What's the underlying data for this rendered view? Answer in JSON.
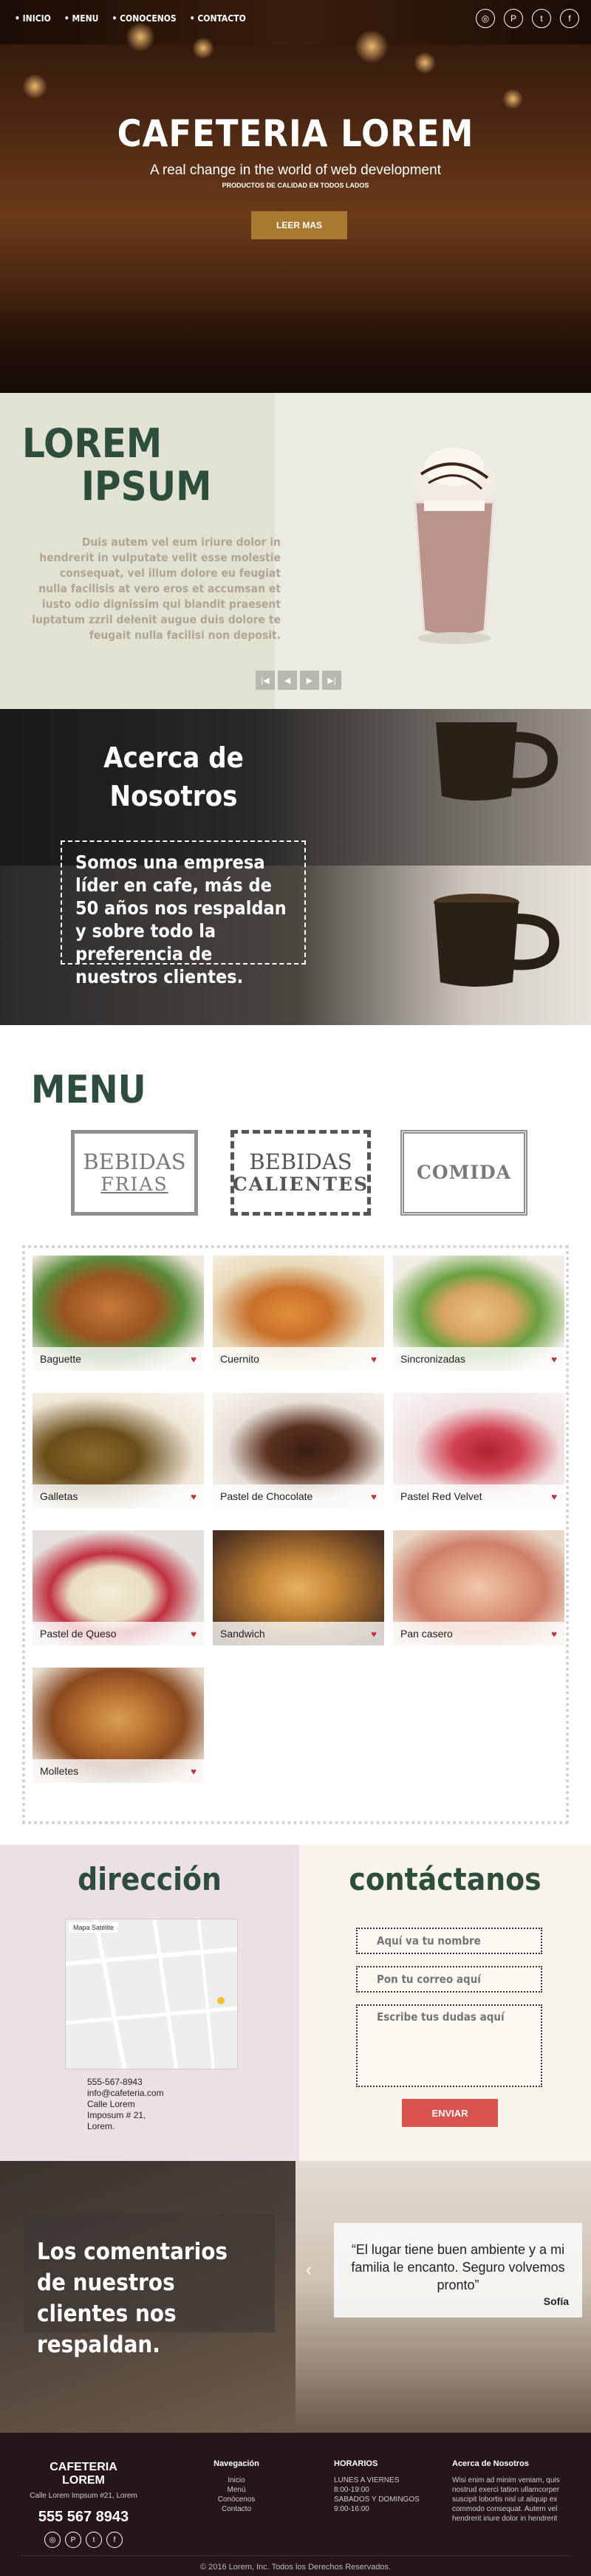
{
  "nav": {
    "items": [
      "• INICIO",
      "• MENU",
      "• CONOCENOS",
      "• CONTACTO"
    ]
  },
  "social": [
    "instagram-icon",
    "pinterest-icon",
    "twitter-icon",
    "facebook-icon"
  ],
  "hero": {
    "title": "CAFETERIA LOREM",
    "subtitle": "A real change in the world of web development",
    "tagline": "PRODUCTOS DE CALIDAD EN TODOS LADOS",
    "button": "LEER MAS"
  },
  "lorem": {
    "title_line1": "LOREM",
    "title_line2": "IPSUM",
    "body": "Duis autem vel eum iriure dolor in hendrerit in vulputate velit esse molestie consequat, vel illum dolore eu feugiat nulla facilisis at vero eros et accumsan et iusto odio dignissim qui blandit praesent luptatum zzril delenit augue duis dolore te feugait nulla facilisi non deposit."
  },
  "about": {
    "title_line1": "Acerca de",
    "title_line2": "Nosotros",
    "body": "Somos una empresa líder en cafe, más de 50 años nos respaldan y sobre todo la preferencia de nuestros clientes."
  },
  "menu": {
    "title": "MENU",
    "categories": [
      {
        "l1": "BEBIDAS",
        "l2": "FRIAS"
      },
      {
        "l1": "BEBIDAS",
        "l2": "CALIENTES"
      },
      {
        "l1": "COMIDA",
        "l2": ""
      }
    ],
    "items": [
      "Baguette",
      "Cuernito",
      "Sincronizadas",
      "Galletas",
      "Pastel de Chocolate",
      "Pastel Red Velvet",
      "Pastel de Queso",
      "Sandwich",
      "Pan casero",
      "Molletes"
    ]
  },
  "contact": {
    "dir_title": "dirección",
    "map_tabs": "Mapa  Satélite",
    "address": [
      "555-567-8943",
      "info@cafeteria.com",
      "Calle Lorem",
      "Imposum # 21,",
      "Lorem."
    ],
    "con_title": "contáctanos",
    "name_placeholder": "Aquí va tu nombre",
    "email_placeholder": "Pon tu correo aquí",
    "msg_placeholder": "Escribe tus dudas aquí",
    "send": "ENVIAR"
  },
  "testimonials": {
    "heading": "Los comentarios de nuestros clientes nos respaldan.",
    "quote": "“El lugar tiene buen ambiente y a mi familia le encanto. Seguro volvemos pronto”",
    "author": "Sofía"
  },
  "footer": {
    "brand_line1": "CAFETERIA",
    "brand_line2": "LOREM",
    "address": "Calle Lorem Impsum #21, Lorem",
    "phone": "555 567 8943",
    "nav_title": "Navegación",
    "nav_items": [
      "Inicio",
      "Menú",
      "Conócenos",
      "Contacto"
    ],
    "hours_title": "HORARIOS",
    "hours": [
      "LUNES A VIERNES",
      "8:00-19:00",
      "SABADOS Y DOMINGOS",
      "9:00-16:00"
    ],
    "about_title": "Acerca de Nosotros",
    "about_text": "Wisi enim ad minim veniam, quis nostrud exerci tation ullamcorper suscipit lobortis nisl ut aliquip ex commodo consequat. Autem vel hendrerit iriure dolor in hendrerit",
    "copyright": "© 2016 Lorem, Inc. Todos los Derechos Reservados."
  }
}
